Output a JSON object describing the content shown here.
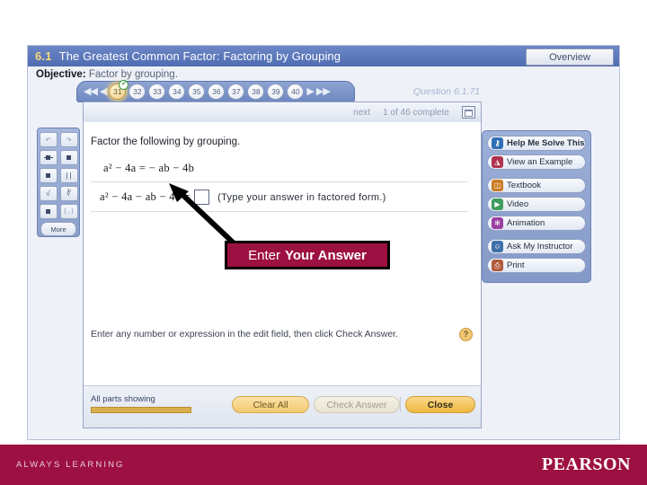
{
  "section": {
    "number": "6.1",
    "title": "The Greatest Common Factor: Factoring by Grouping",
    "overview_label": "Overview",
    "objective_label": "Objective:",
    "objective_text": "Factor by grouping."
  },
  "pager": {
    "first_icon": "◀◀",
    "prev_icon": "◀",
    "next_icon": "▶",
    "last_icon": "▶▶",
    "check_badge": "✓",
    "numbers": [
      "31",
      "32",
      "33",
      "34",
      "35",
      "36",
      "37",
      "38",
      "39",
      "40"
    ],
    "current": "31"
  },
  "question_id": "Question 6.1.71",
  "dialog": {
    "next_label": "next",
    "progress_label": "1 of 46 complete",
    "prompt": "Factor the following by grouping.",
    "equation_line1": "a² − 4a = − ab − 4b",
    "equation_line2_left": "a² − 4a − ab − 4b =",
    "answer_value": "",
    "answer_hint": "(Type your answer in factored form.)",
    "instruction": "Enter any number or expression in the edit field, then click Check Answer.",
    "help_glyph": "?",
    "parts_label": "All parts showing",
    "clear_label": "Clear All",
    "check_label": "Check Answer",
    "close_label": "Close"
  },
  "palette": {
    "keys": [
      {
        "name": "undo",
        "glyph": "↶"
      },
      {
        "name": "redo",
        "glyph": "↷"
      },
      {
        "name": "fraction",
        "glyph": ""
      },
      {
        "name": "mixed-number",
        "glyph": ""
      },
      {
        "name": "exponent",
        "glyph": ""
      },
      {
        "name": "absolute-value",
        "glyph": "| |"
      },
      {
        "name": "square-root",
        "glyph": "√"
      },
      {
        "name": "nth-root",
        "glyph": "∛"
      },
      {
        "name": "subscript",
        "glyph": ""
      },
      {
        "name": "interval",
        "glyph": "( , )"
      }
    ],
    "more_label": "More"
  },
  "helpers": [
    {
      "label": "Help Me Solve This",
      "icon": "key-icon",
      "color": "#2f6fb5",
      "glyph": "⚷",
      "bold": true
    },
    {
      "label": "View an Example",
      "icon": "bag-icon",
      "color": "#b0344d",
      "glyph": "◮",
      "bold": false
    },
    {
      "label": "Textbook",
      "icon": "book-icon",
      "color": "#cc7a22",
      "glyph": "◫",
      "bold": false
    },
    {
      "label": "Video",
      "icon": "video-icon",
      "color": "#3f9b5e",
      "glyph": "▶",
      "bold": false
    },
    {
      "label": "Animation",
      "icon": "animation-icon",
      "color": "#9b3fa0",
      "glyph": "✻",
      "bold": false
    },
    {
      "label": "Ask My Instructor",
      "icon": "instructor-icon",
      "color": "#3f6fa8",
      "glyph": "☺",
      "bold": false
    },
    {
      "label": "Print",
      "icon": "printer-icon",
      "color": "#b05a3a",
      "glyph": "⎙",
      "bold": false
    }
  ],
  "callout": {
    "word1": "Enter",
    "word2": "Your Answer",
    "bg_color": "#9d1042"
  },
  "footer": {
    "tagline": "ALWAYS LEARNING",
    "brand": "PEARSON",
    "bg_color": "#9d1042"
  }
}
